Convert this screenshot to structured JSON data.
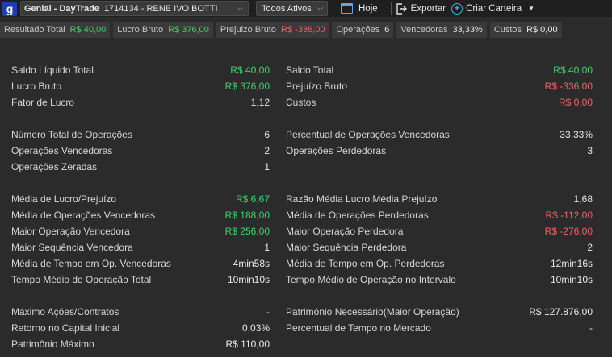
{
  "toolbar": {
    "logo_letter": "g",
    "account_broker": "Genial - DayTrade",
    "account_id": "1714134 - RENE IVO BOTTI",
    "assets_filter": "Todos Ativos",
    "today_label": "Hoje",
    "export_label": "Exportar",
    "create_portfolio_label": "Criar Carteira"
  },
  "summary": [
    {
      "label": "Resultado Total",
      "value": "R$ 40,00",
      "tone": "pos"
    },
    {
      "label": "Lucro Bruto",
      "value": "R$ 376,00",
      "tone": "pos"
    },
    {
      "label": "Prejuizo Bruto",
      "value": "R$ -336,00",
      "tone": "neg"
    },
    {
      "label": "Operações",
      "value": "6",
      "tone": "neutral"
    },
    {
      "label": "Vencedoras",
      "value": "33,33%",
      "tone": "neutral"
    },
    {
      "label": "Custos",
      "value": "R$ 0,00",
      "tone": "neutral"
    }
  ],
  "left": [
    {
      "label": "Saldo Líquido Total",
      "value": "R$ 40,00",
      "tone": "pos"
    },
    {
      "label": "Lucro Bruto",
      "value": "R$ 376,00",
      "tone": "pos"
    },
    {
      "label": "Fator de Lucro",
      "value": "1,12",
      "tone": "neutral"
    },
    {
      "label": "Número Total de Operações",
      "value": "6",
      "tone": "neutral"
    },
    {
      "label": "Operações Vencedoras",
      "value": "2",
      "tone": "neutral"
    },
    {
      "label": "Operações Zeradas",
      "value": "1",
      "tone": "neutral"
    },
    {
      "label": "Média de Lucro/Prejuízo",
      "value": "R$ 6,67",
      "tone": "pos"
    },
    {
      "label": "Média de Operações Vencedoras",
      "value": "R$ 188,00",
      "tone": "pos"
    },
    {
      "label": "Maior Operação Vencedora",
      "value": "R$ 256,00",
      "tone": "pos"
    },
    {
      "label": "Maior Sequência Vencedora",
      "value": "1",
      "tone": "neutral"
    },
    {
      "label": "Média de Tempo em Op. Vencedoras",
      "value": "4min58s",
      "tone": "neutral"
    },
    {
      "label": "Tempo Médio de Operação Total",
      "value": "10min10s",
      "tone": "neutral"
    },
    {
      "label": "Máximo Ações/Contratos",
      "value": "-",
      "tone": "neutral"
    },
    {
      "label": "Retorno no Capital Inicial",
      "value": "0,03%",
      "tone": "neutral"
    },
    {
      "label": "Patrimônio Máximo",
      "value": "R$ 110,00",
      "tone": "neutral"
    }
  ],
  "right": [
    {
      "label": "Saldo Total",
      "value": "R$ 40,00",
      "tone": "pos"
    },
    {
      "label": "Prejuízo Bruto",
      "value": "R$ -336,00",
      "tone": "neg"
    },
    {
      "label": "Custos",
      "value": "R$ 0,00",
      "tone": "neg"
    },
    {
      "label": "Percentual de Operações Vencedoras",
      "value": "33,33%",
      "tone": "neutral"
    },
    {
      "label": "Operações Perdedoras",
      "value": "3",
      "tone": "neutral"
    },
    {
      "label": "Razão Média Lucro:Média Prejuízo",
      "value": "1,68",
      "tone": "neutral"
    },
    {
      "label": "Média de Operações Perdedoras",
      "value": "R$ -112,00",
      "tone": "neg"
    },
    {
      "label": "Maior Operação Perdedora",
      "value": "R$ -276,00",
      "tone": "neg"
    },
    {
      "label": "Maior Sequência Perdedora",
      "value": "2",
      "tone": "neutral"
    },
    {
      "label": "Média de Tempo em Op. Perdedoras",
      "value": "12min16s",
      "tone": "neutral"
    },
    {
      "label": "Tempo Médio de Operação no Intervalo",
      "value": "10min10s",
      "tone": "neutral"
    },
    {
      "label": "Patrimônio Necessário(Maior Operação)",
      "value": "R$ 127.876,00",
      "tone": "neutral"
    },
    {
      "label": "Percentual de Tempo no Mercado",
      "value": "-",
      "tone": "neutral"
    }
  ],
  "colors": {
    "positive": "#3fd26b",
    "negative": "#f06262",
    "background": "#2b2b2b"
  }
}
